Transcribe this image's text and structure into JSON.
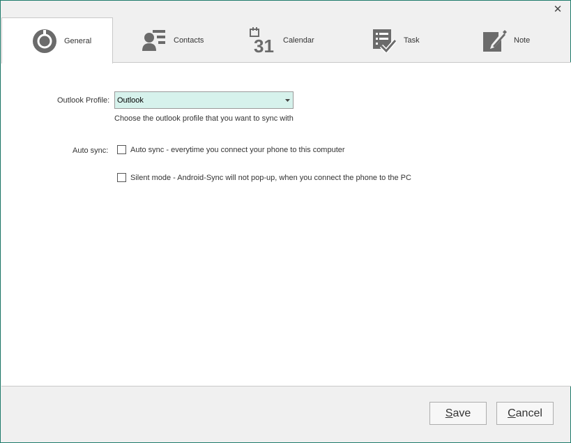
{
  "window": {
    "close_glyph": "✕"
  },
  "tabs": [
    {
      "label": "General",
      "icon": "gear-icon",
      "active": true
    },
    {
      "label": "Contacts",
      "icon": "contacts-icon",
      "active": false
    },
    {
      "label": "Calendar",
      "icon": "calendar-icon",
      "active": false
    },
    {
      "label": "Task",
      "icon": "task-checklist-icon",
      "active": false
    },
    {
      "label": "Note",
      "icon": "note-pencil-icon",
      "active": false
    }
  ],
  "general": {
    "profile_label": "Outlook Profile:",
    "profile_value": "Outlook",
    "profile_hint": "Choose the outlook profile that you want to sync with",
    "auto_sync_label": "Auto sync:",
    "auto_sync_option": "Auto sync - everytime you connect your phone to this computer",
    "auto_sync_checked": false,
    "silent_mode_option": "Silent mode - Android-Sync will not pop-up, when you connect the phone to the PC",
    "silent_mode_checked": false
  },
  "buttons": {
    "save_first": "S",
    "save_rest": "ave",
    "cancel_first": "C",
    "cancel_rest": "ancel"
  },
  "calendar_icon_number": "31",
  "colors": {
    "accent_border": "#1e7a6a",
    "select_bg": "#d6f2ec",
    "icon_gray": "#6b6b6b"
  }
}
